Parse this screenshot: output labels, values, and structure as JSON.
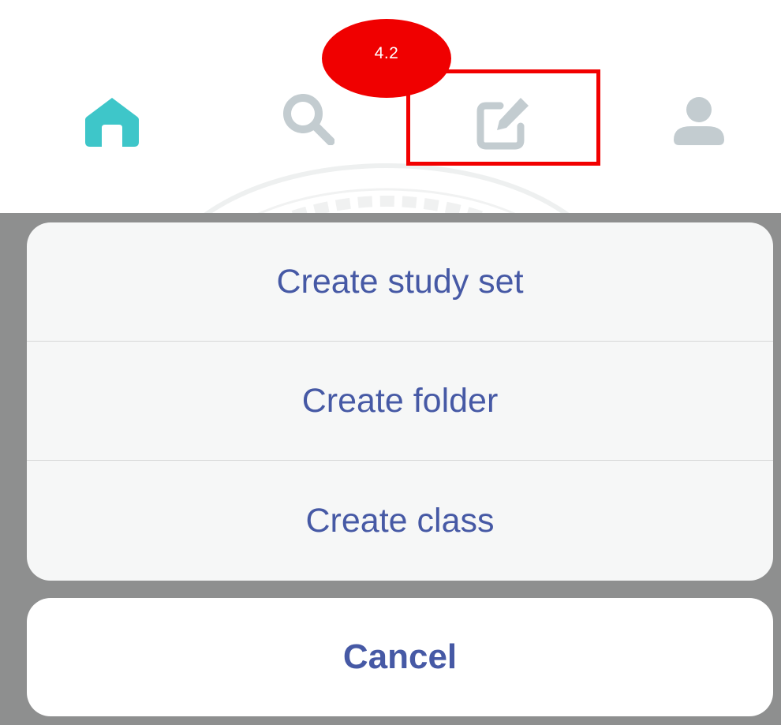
{
  "tabbar": {
    "tabs": [
      {
        "id": "home",
        "icon": "home-icon",
        "active": true
      },
      {
        "id": "search",
        "icon": "search-icon",
        "active": false
      },
      {
        "id": "create",
        "icon": "edit-icon",
        "active": false
      },
      {
        "id": "profile",
        "icon": "profile-icon",
        "active": false
      }
    ],
    "active_color": "#3ec6c9",
    "inactive_color": "#c3ccd0"
  },
  "annotation": {
    "label": "4.2",
    "color": "#f20000"
  },
  "action_sheet": {
    "items": [
      {
        "label": "Create study set"
      },
      {
        "label": "Create folder"
      },
      {
        "label": "Create class"
      }
    ],
    "cancel_label": "Cancel",
    "text_color": "#4659a5"
  }
}
